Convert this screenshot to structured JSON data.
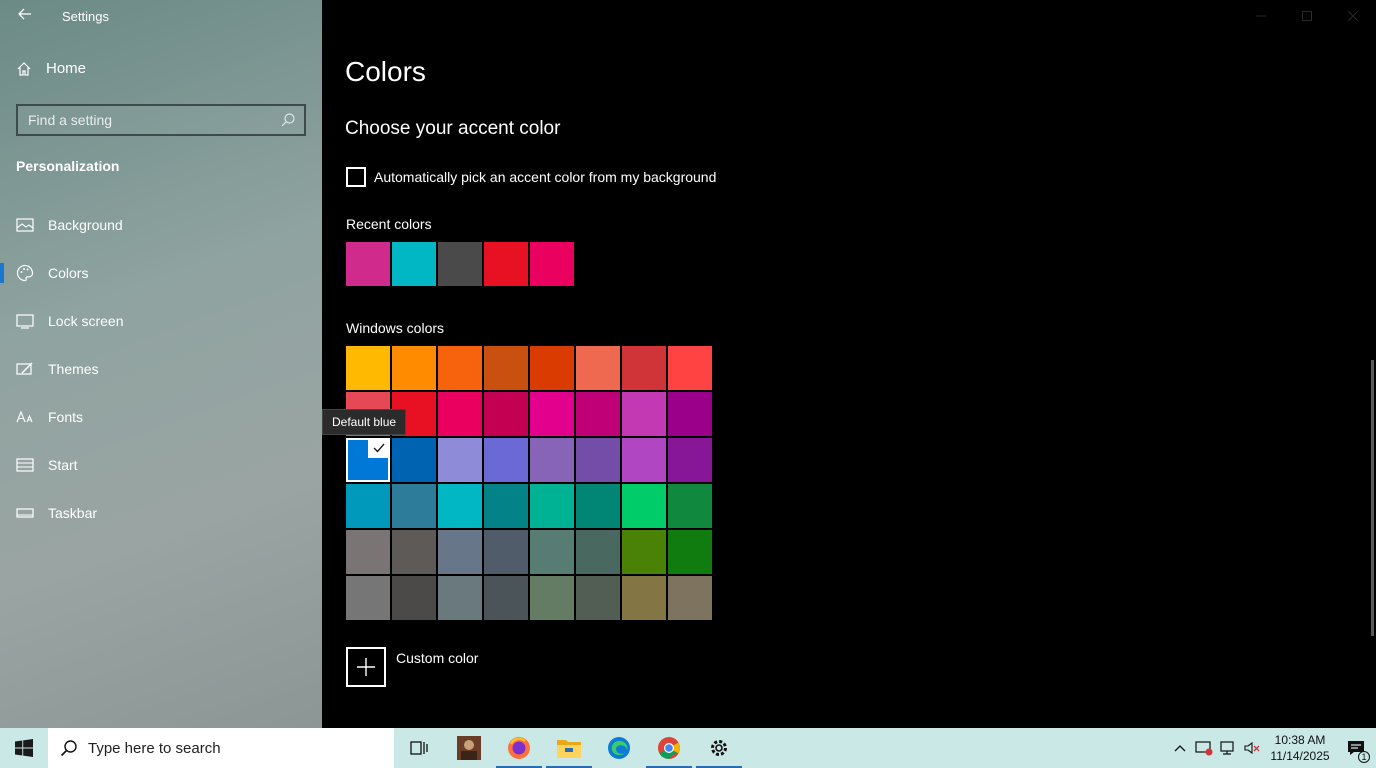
{
  "window": {
    "title": "Settings"
  },
  "sidebar": {
    "home_label": "Home",
    "search_placeholder": "Find a setting",
    "section_title": "Personalization",
    "items": [
      {
        "label": "Background",
        "icon": "picture-icon",
        "active": false
      },
      {
        "label": "Colors",
        "icon": "palette-icon",
        "active": true
      },
      {
        "label": "Lock screen",
        "icon": "lock-screen-icon",
        "active": false
      },
      {
        "label": "Themes",
        "icon": "themes-icon",
        "active": false
      },
      {
        "label": "Fonts",
        "icon": "fonts-icon",
        "active": false
      },
      {
        "label": "Start",
        "icon": "start-icon",
        "active": false
      },
      {
        "label": "Taskbar",
        "icon": "taskbar-icon",
        "active": false
      }
    ]
  },
  "main": {
    "title": "Colors",
    "subtitle": "Choose your accent color",
    "auto_pick_label": "Automatically pick an accent color from my background",
    "auto_pick_checked": false,
    "recent_label": "Recent colors",
    "recent_colors": [
      "#cf2a8c",
      "#00b7c3",
      "#4a4a4a",
      "#e81123",
      "#ea005e"
    ],
    "windows_label": "Windows colors",
    "windows_colors": [
      "#ffb900",
      "#ff8c00",
      "#f7630c",
      "#ca5010",
      "#da3b01",
      "#ef6950",
      "#d13438",
      "#ff4343",
      "#e74856",
      "#e81123",
      "#ea005e",
      "#c30052",
      "#e3008c",
      "#bf0077",
      "#c239b3",
      "#9a0089",
      "#0078d7",
      "#0063b1",
      "#8e8cd8",
      "#6b69d6",
      "#8764b8",
      "#744da9",
      "#b146c2",
      "#881798",
      "#0099bc",
      "#2d7d9a",
      "#00b7c3",
      "#038387",
      "#00b294",
      "#018574",
      "#00cc6a",
      "#10893e",
      "#7a7574",
      "#5d5a58",
      "#68768a",
      "#515c6b",
      "#567c73",
      "#486860",
      "#498205",
      "#107c10",
      "#767676",
      "#4c4a48",
      "#69797e",
      "#4a5459",
      "#647c64",
      "#525e54",
      "#847545",
      "#7e735f"
    ],
    "selected_index": 16,
    "tooltip": "Default blue",
    "custom_label": "Custom color"
  },
  "taskbar": {
    "search_placeholder": "Type here to search",
    "apps": [
      {
        "name": "task-view-icon",
        "running": false
      },
      {
        "name": "photo-app-icon",
        "running": false
      },
      {
        "name": "firefox-icon",
        "running": true
      },
      {
        "name": "file-explorer-icon",
        "running": true
      },
      {
        "name": "edge-icon",
        "running": false
      },
      {
        "name": "chrome-icon",
        "running": true
      },
      {
        "name": "settings-icon",
        "running": true
      }
    ],
    "time": "10:38 AM",
    "date": "11/14/2025",
    "notification_count": "1"
  }
}
